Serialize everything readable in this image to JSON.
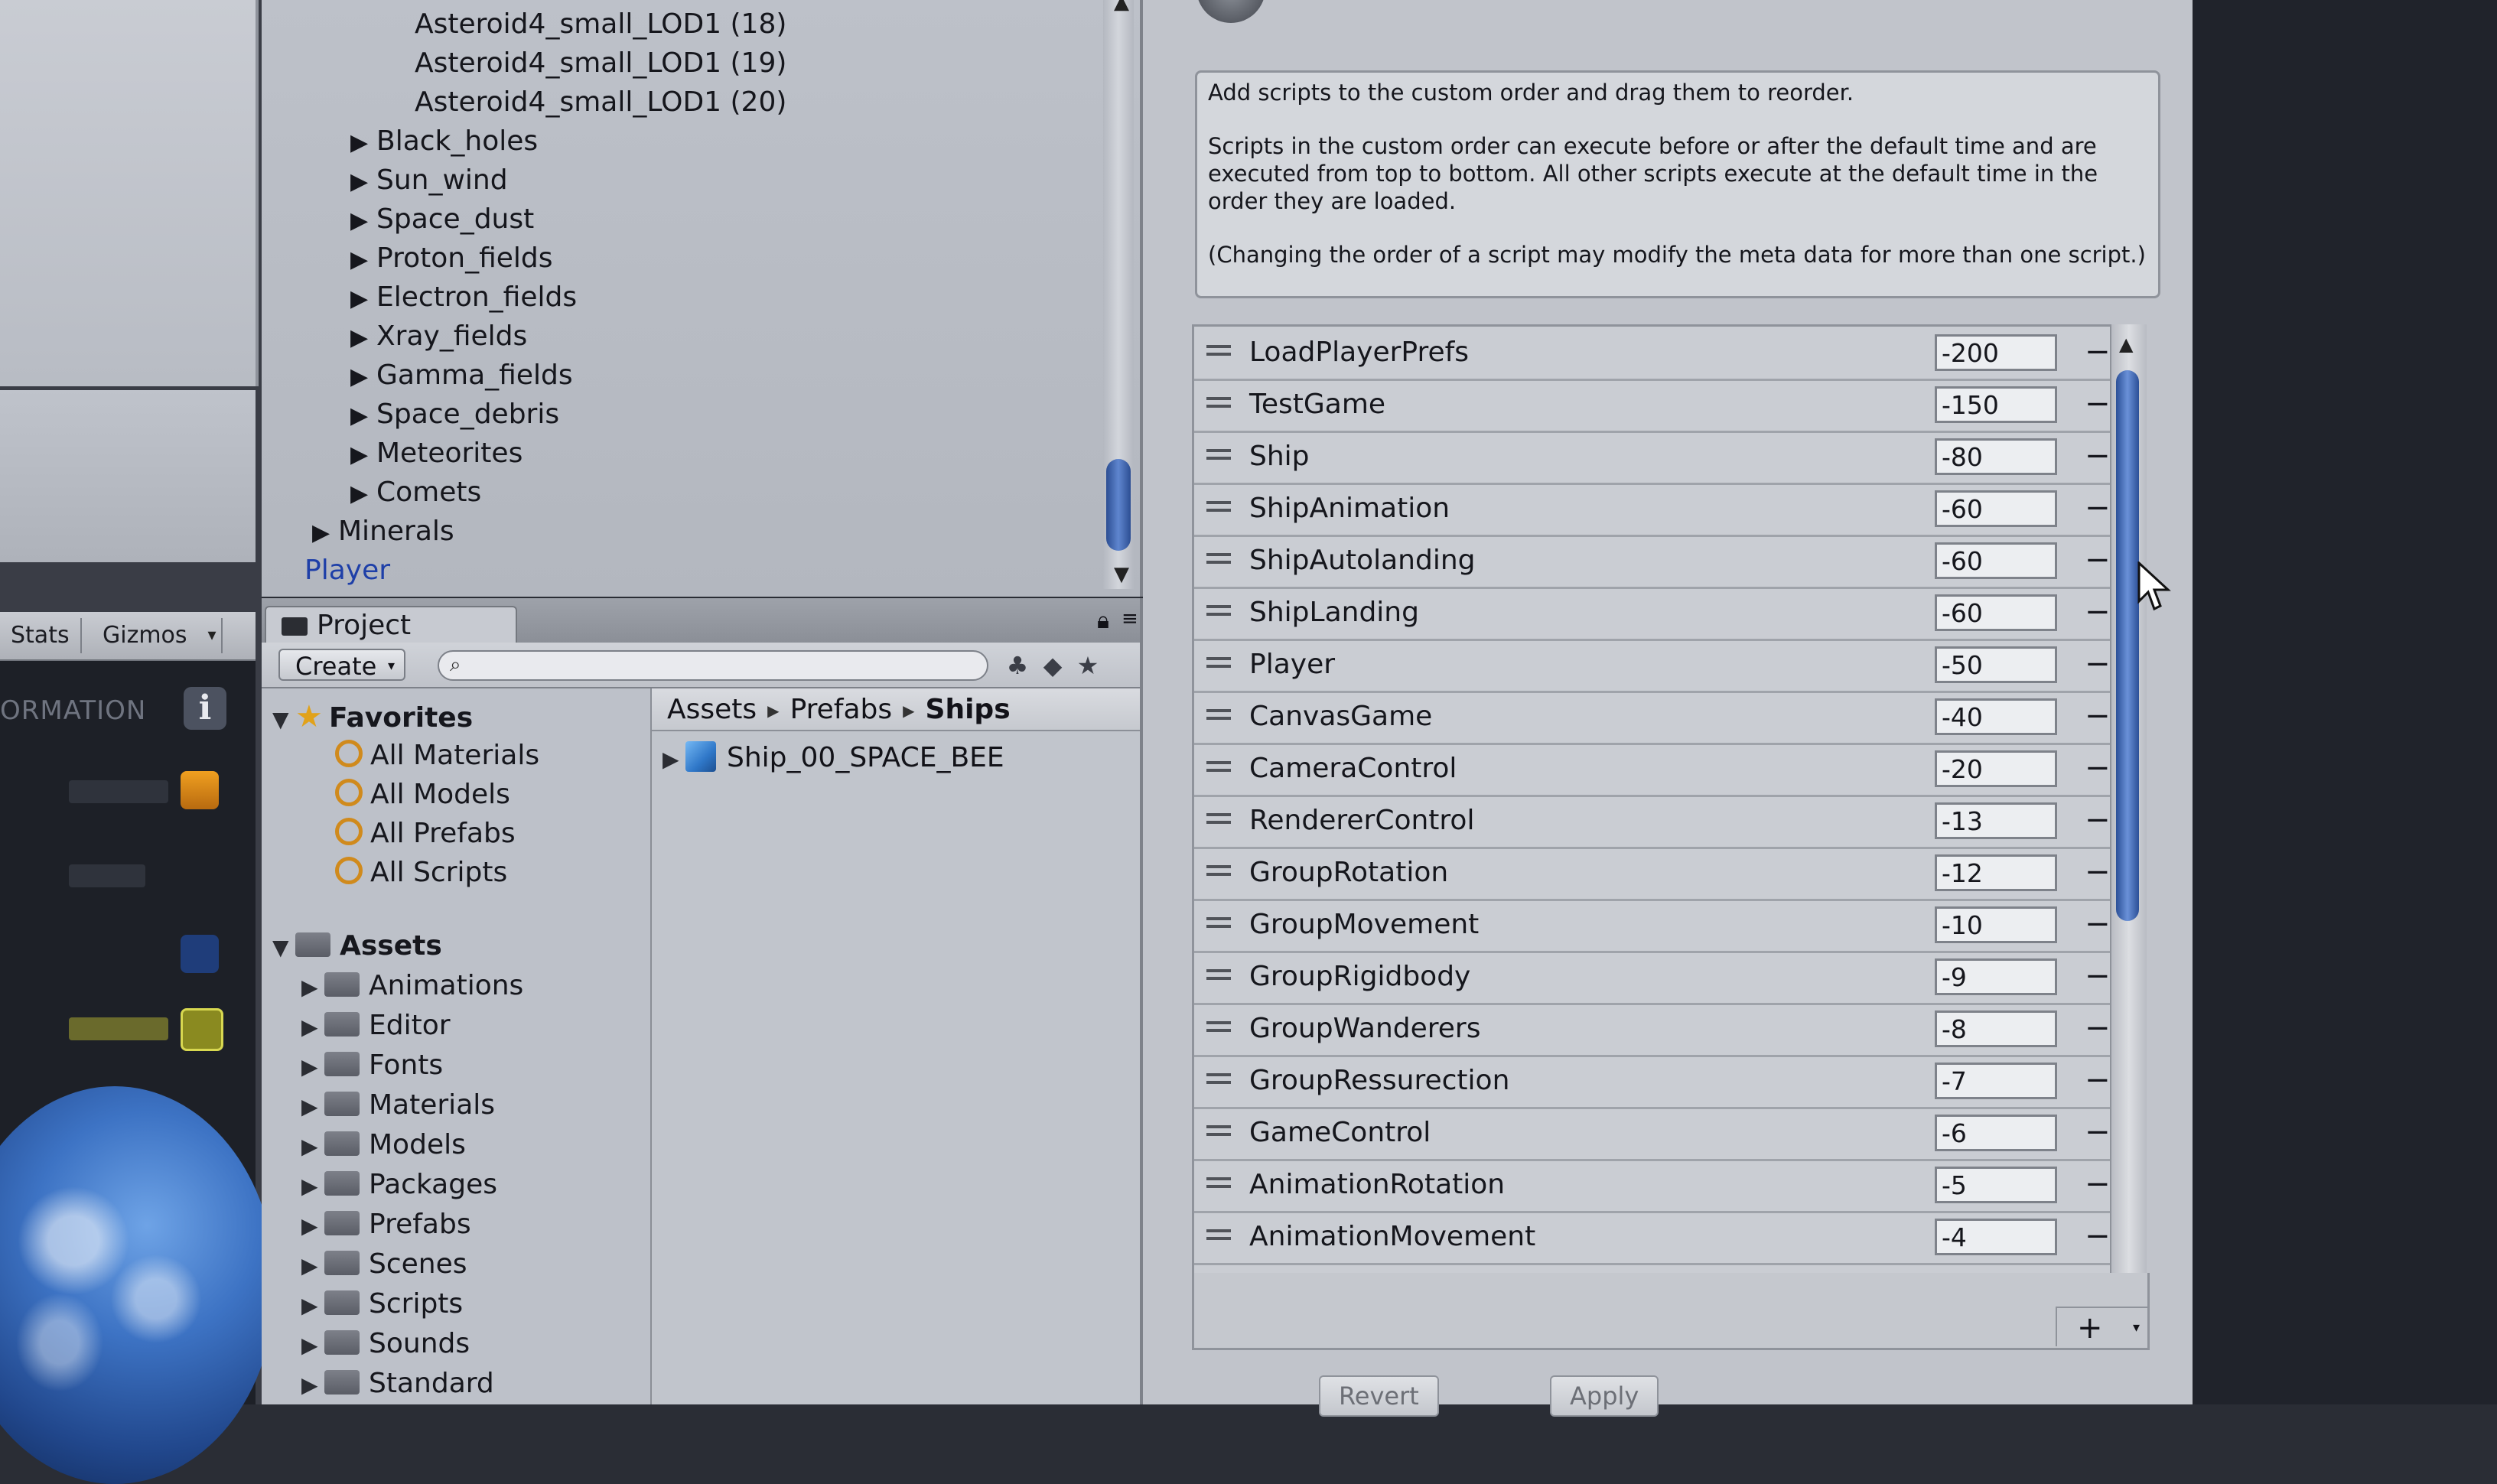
{
  "hierarchy": {
    "items": [
      {
        "label": "Asteroid4_small_LOD1 (18)",
        "has_arrow": false
      },
      {
        "label": "Asteroid4_small_LOD1 (19)",
        "has_arrow": false
      },
      {
        "label": "Asteroid4_small_LOD1 (20)",
        "has_arrow": false
      },
      {
        "label": "Black_holes",
        "has_arrow": true
      },
      {
        "label": "Sun_wind",
        "has_arrow": true
      },
      {
        "label": "Space_dust",
        "has_arrow": true
      },
      {
        "label": "Proton_fields",
        "has_arrow": true
      },
      {
        "label": "Electron_fields",
        "has_arrow": true
      },
      {
        "label": "Xray_fields",
        "has_arrow": true
      },
      {
        "label": "Gamma_fields",
        "has_arrow": true
      },
      {
        "label": "Space_debris",
        "has_arrow": true
      },
      {
        "label": "Meteorites",
        "has_arrow": true
      },
      {
        "label": "Comets",
        "has_arrow": true
      },
      {
        "label": "Minerals",
        "has_arrow": true
      },
      {
        "label": "Player",
        "has_arrow": false,
        "selected": true
      }
    ],
    "arrow_glyph": "▶"
  },
  "left_panel": {
    "stats_label": "Stats",
    "gizmos_label": "Gizmos",
    "info_banner": "ORMATION"
  },
  "project": {
    "tab_label": "Project",
    "create_label": "Create",
    "search_value": "",
    "favorites_label": "Favorites",
    "favorites": [
      "All Materials",
      "All Models",
      "All Prefabs",
      "All Scripts"
    ],
    "assets_label": "Assets",
    "asset_folders": [
      "Animations",
      "Editor",
      "Fonts",
      "Materials",
      "Models",
      "Packages",
      "Prefabs",
      "Scenes",
      "Scripts",
      "Sounds",
      "Standard"
    ],
    "breadcrumb": [
      "Assets",
      "Prefabs",
      "Ships"
    ],
    "content_items": [
      "Ship_00_SPACE_BEE"
    ]
  },
  "inspector": {
    "help_text": [
      "Add scripts to the custom order and drag them to reorder.",
      "Scripts in the custom order can execute before or after the default time and are executed from top to bottom. All other scripts execute at the default time in the order they are loaded.",
      "(Changing the order of a script may modify the meta data for more than one script.)"
    ],
    "scripts": [
      {
        "name": "LoadPlayerPrefs",
        "order": "-200"
      },
      {
        "name": "TestGame",
        "order": "-150"
      },
      {
        "name": "Ship",
        "order": "-80"
      },
      {
        "name": "ShipAnimation",
        "order": "-60"
      },
      {
        "name": "ShipAutolanding",
        "order": "-60"
      },
      {
        "name": "ShipLanding",
        "order": "-60"
      },
      {
        "name": "Player",
        "order": "-50"
      },
      {
        "name": "CanvasGame",
        "order": "-40"
      },
      {
        "name": "CameraControl",
        "order": "-20"
      },
      {
        "name": "RendererControl",
        "order": "-13"
      },
      {
        "name": "GroupRotation",
        "order": "-12"
      },
      {
        "name": "GroupMovement",
        "order": "-10"
      },
      {
        "name": "GroupRigidbody",
        "order": "-9"
      },
      {
        "name": "GroupWanderers",
        "order": "-8"
      },
      {
        "name": "GroupRessurection",
        "order": "-7"
      },
      {
        "name": "GameControl",
        "order": "-6"
      },
      {
        "name": "AnimationRotation",
        "order": "-5"
      },
      {
        "name": "AnimationMovement",
        "order": "-4"
      }
    ],
    "remove_glyph": "−",
    "add_glyph": "+",
    "revert_label": "Revert",
    "apply_label": "Apply"
  },
  "colors": {
    "selection_blue": "#1e3fa8",
    "scroll_thumb": "#2b4f97",
    "panel_bg": "#c1c4cb",
    "favorite_star": "#e1a21a"
  },
  "icons": {
    "favorites": "star-icon",
    "search": "magnifier-icon",
    "folder": "folder-icon",
    "prefab": "cube-icon",
    "lock": "lock-icon"
  }
}
